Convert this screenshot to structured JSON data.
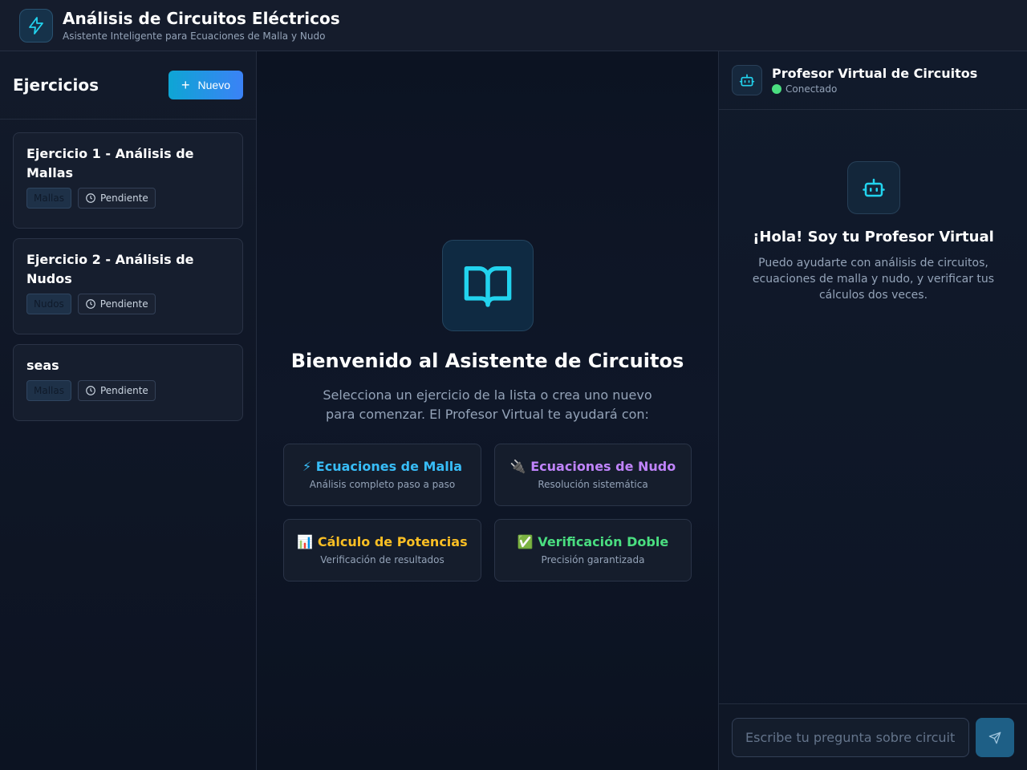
{
  "header": {
    "title": "Análisis de Circuitos Eléctricos",
    "subtitle": "Asistente Inteligente para Ecuaciones de Malla y Nudo",
    "logo_icon": "lightning-icon"
  },
  "sidebar": {
    "title": "Ejercicios",
    "new_button_label": "Nuevo",
    "exercises": [
      {
        "title": "Ejercicio 1 - Análisis de Mallas",
        "type": "Mallas",
        "status": "Pendiente"
      },
      {
        "title": "Ejercicio 2 - Análisis de Nudos",
        "type": "Nudos",
        "status": "Pendiente"
      },
      {
        "title": "seas",
        "type": "Mallas",
        "status": "Pendiente"
      }
    ]
  },
  "main": {
    "icon": "book-open-icon",
    "title": "Bienvenido al Asistente de Circuitos",
    "description": "Selecciona un ejercicio de la lista o crea uno nuevo para comenzar. El Profesor Virtual te ayudará con:",
    "features": [
      {
        "title": "⚡ Ecuaciones de Malla",
        "description": "Análisis completo paso a paso",
        "color": "#38bdf8"
      },
      {
        "title": "🔌 Ecuaciones de Nudo",
        "description": "Resolución sistemática",
        "color": "#c084fc"
      },
      {
        "title": "📊 Cálculo de Potencias",
        "description": "Verificación de resultados",
        "color": "#fbbf24"
      },
      {
        "title": "✅ Verificación Doble",
        "description": "Precisión garantizada",
        "color": "#4ade80"
      }
    ]
  },
  "chat": {
    "title": "Profesor Virtual de Circuitos",
    "status": "Conectado",
    "status_color": "#4ade80",
    "greeting_title": "¡Hola! Soy tu Profesor Virtual",
    "greeting_text": "Puedo ayudarte con análisis de circuitos, ecuaciones de malla y nudo, y verificar tus cálculos dos veces.",
    "input_placeholder": "Escribe tu pregunta sobre circuitos...",
    "input_value": ""
  },
  "colors": {
    "accent": "#22d3ee",
    "button_gradient_start": "#0ea5d4",
    "button_gradient_end": "#3b82f6"
  }
}
